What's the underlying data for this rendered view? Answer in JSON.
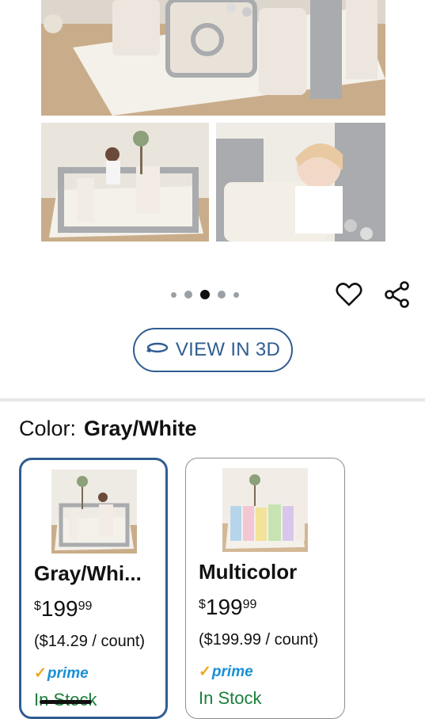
{
  "gallery": {
    "view_3d_label": "VIEW IN 3D",
    "pager": {
      "count": 5,
      "active_index": 2
    }
  },
  "color_selector": {
    "label": "Color:",
    "selected": "Gray/White",
    "options": [
      {
        "name": "Gray/Whi...",
        "price_currency": "$",
        "price_whole": "199",
        "price_cents": "99",
        "unit_price": "($14.29 / count)",
        "prime_label": "prime",
        "stock": "In Stock"
      },
      {
        "name": "Multicolor",
        "price_currency": "$",
        "price_whole": "199",
        "price_cents": "99",
        "unit_price": "($199.99 / count)",
        "prime_label": "prime",
        "stock": "In Stock"
      }
    ]
  },
  "colors": {
    "accent": "#2f5d91",
    "prime": "#1a8fd6",
    "in_stock": "#1b7f3b"
  },
  "icons": [
    "heart-icon",
    "share-icon",
    "rotate-3d-icon",
    "prime-check-icon"
  ]
}
